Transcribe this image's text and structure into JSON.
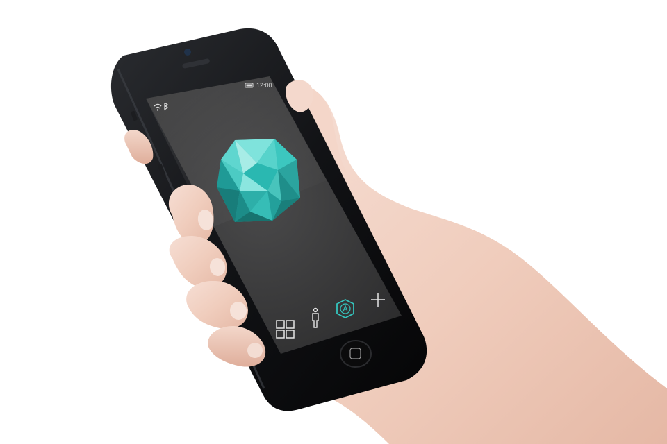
{
  "status_bar": {
    "time": "12:00",
    "wifi_icon": "wifi-icon",
    "bluetooth_icon": "bluetooth-icon",
    "battery_icon": "battery-icon"
  },
  "app": {
    "logo": "faceted-teal-hexagon-gem",
    "accent_color": "#35c4bd",
    "screen_color": "#3a3a3a"
  },
  "tab_bar": {
    "items": [
      {
        "icon": "grid-icon"
      },
      {
        "icon": "person-icon"
      },
      {
        "icon": "hexagon-a-icon",
        "selected": true
      },
      {
        "icon": "plus-icon"
      }
    ]
  }
}
